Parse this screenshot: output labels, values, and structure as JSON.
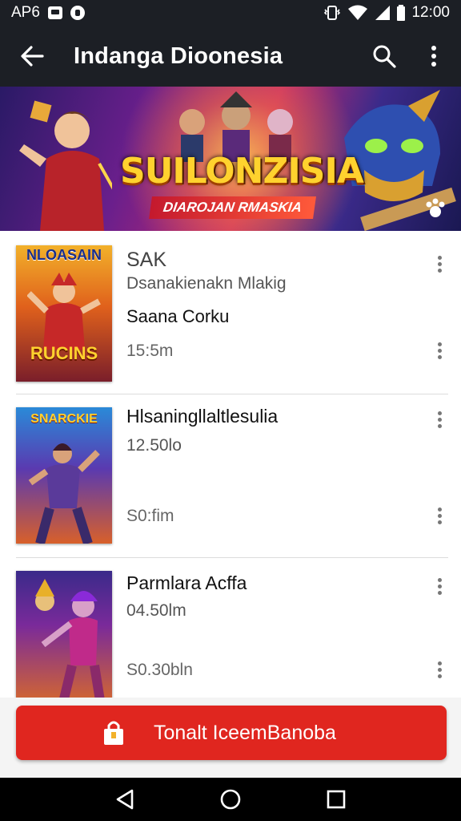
{
  "status_bar": {
    "carrier": "AP6",
    "time": "12:00"
  },
  "app_bar": {
    "title": "Indanga Dioonesia"
  },
  "banner": {
    "title": "SUILONZISIA",
    "subtitle": "DIAROJAN RMASKIA"
  },
  "items": [
    {
      "cover_text": "NLOASAIN",
      "cover_text_2": "RUCINS",
      "title": "SAK",
      "subtitle": "Dsanakienakn Mlakig",
      "name": "Saana Corku",
      "value": "15:5m"
    },
    {
      "cover_text": "SNARCKIE",
      "title": "Hlsaningllaltlesulia",
      "subtitle": "12.50lo",
      "value": "S0:fim"
    },
    {
      "title": "Parmlara Acffa",
      "subtitle": "04.50lm",
      "value": "S0.30bln"
    }
  ],
  "cta": {
    "label": "Tonalt IceemBanoba"
  },
  "colors": {
    "app_bar": "#1c1f25",
    "cta": "#e0261f"
  }
}
